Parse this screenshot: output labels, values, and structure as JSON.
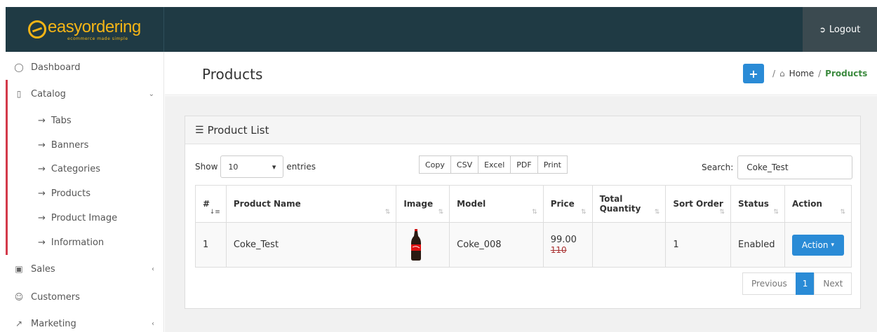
{
  "brand": {
    "name": "easyordering",
    "tagline": "ecommerce made simple"
  },
  "topbar": {
    "logout_label": "Logout"
  },
  "sidebar": {
    "items": [
      {
        "label": "Dashboard",
        "icon": "dashboard-icon"
      },
      {
        "label": "Catalog",
        "icon": "catalog-icon",
        "expanded": true
      },
      {
        "label": "Sales",
        "icon": "cart-icon"
      },
      {
        "label": "Customers",
        "icon": "user-icon"
      },
      {
        "label": "Marketing",
        "icon": "marketing-icon"
      }
    ],
    "catalog_children": [
      "Tabs",
      "Banners",
      "Categories",
      "Products",
      "Product Image",
      "Information"
    ]
  },
  "header": {
    "title": "Products",
    "breadcrumb": {
      "home": "Home",
      "separator": "/",
      "current": "Products"
    }
  },
  "panel": {
    "title": "Product List",
    "show_label": "Show",
    "entries_value": "10",
    "entries_label": "entries",
    "export_buttons": [
      "Copy",
      "CSV",
      "Excel",
      "PDF",
      "Print"
    ],
    "search_label": "Search:",
    "search_value": "Coke_Test"
  },
  "table": {
    "columns": [
      "#",
      "Product Name",
      "Image",
      "Model",
      "Price",
      "Total Quantity",
      "Sort Order",
      "Status",
      "Action"
    ],
    "rows": [
      {
        "num": "1",
        "name": "Coke_Test",
        "model": "Coke_008",
        "price_new": "99.00",
        "price_old": "110",
        "total_quantity": "",
        "sort_order": "1",
        "status": "Enabled",
        "action_label": "Action"
      }
    ]
  },
  "pagination": {
    "previous": "Previous",
    "current": "1",
    "next": "Next"
  },
  "colors": {
    "topbar": "#1f3a44",
    "brand": "#f4b416",
    "primary": "#2a8bd6",
    "active_crumb": "#3b8a3e",
    "catalog_accent": "#d33a4b"
  }
}
